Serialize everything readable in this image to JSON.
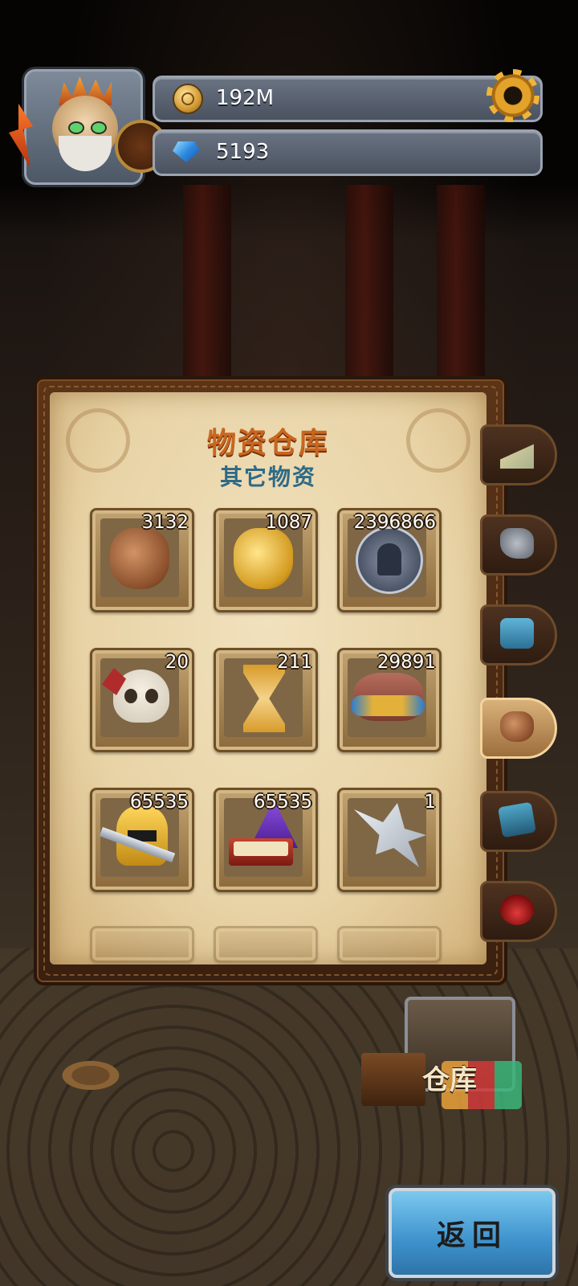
{
  "hud": {
    "gold": "192M",
    "gems": "5193",
    "gold_icon": "gold-coin-icon",
    "gem_icon": "blue-gem-icon",
    "settings_icon": "gear-icon"
  },
  "panel": {
    "title": "物资仓库",
    "subtitle": "其它物资",
    "items": [
      {
        "icon": "bronze-vase-icon",
        "count": "3132"
      },
      {
        "icon": "gold-vase-icon",
        "count": "1087"
      },
      {
        "icon": "silver-helmet-medal-icon",
        "count": "2396866"
      },
      {
        "icon": "skull-feather-gem-icon",
        "count": "20"
      },
      {
        "icon": "hourglass-icon",
        "count": "211"
      },
      {
        "icon": "hat-goggles-icon",
        "count": "29891"
      },
      {
        "icon": "gold-helmet-sword-icon",
        "count": "65535"
      },
      {
        "icon": "wizard-hat-book-icon",
        "count": "65535"
      },
      {
        "icon": "silver-wing-icon",
        "count": "1"
      }
    ]
  },
  "side_tabs": [
    {
      "icon": "cheese-icon",
      "active": false
    },
    {
      "icon": "ore-icon",
      "active": false
    },
    {
      "icon": "puzzle-piece-icon",
      "active": false
    },
    {
      "icon": "vase-icon",
      "active": true
    },
    {
      "icon": "blue-scroll-icon",
      "active": false
    },
    {
      "icon": "red-potion-icon",
      "active": false
    }
  ],
  "warehouse_label": "仓库",
  "back_button": "返回"
}
